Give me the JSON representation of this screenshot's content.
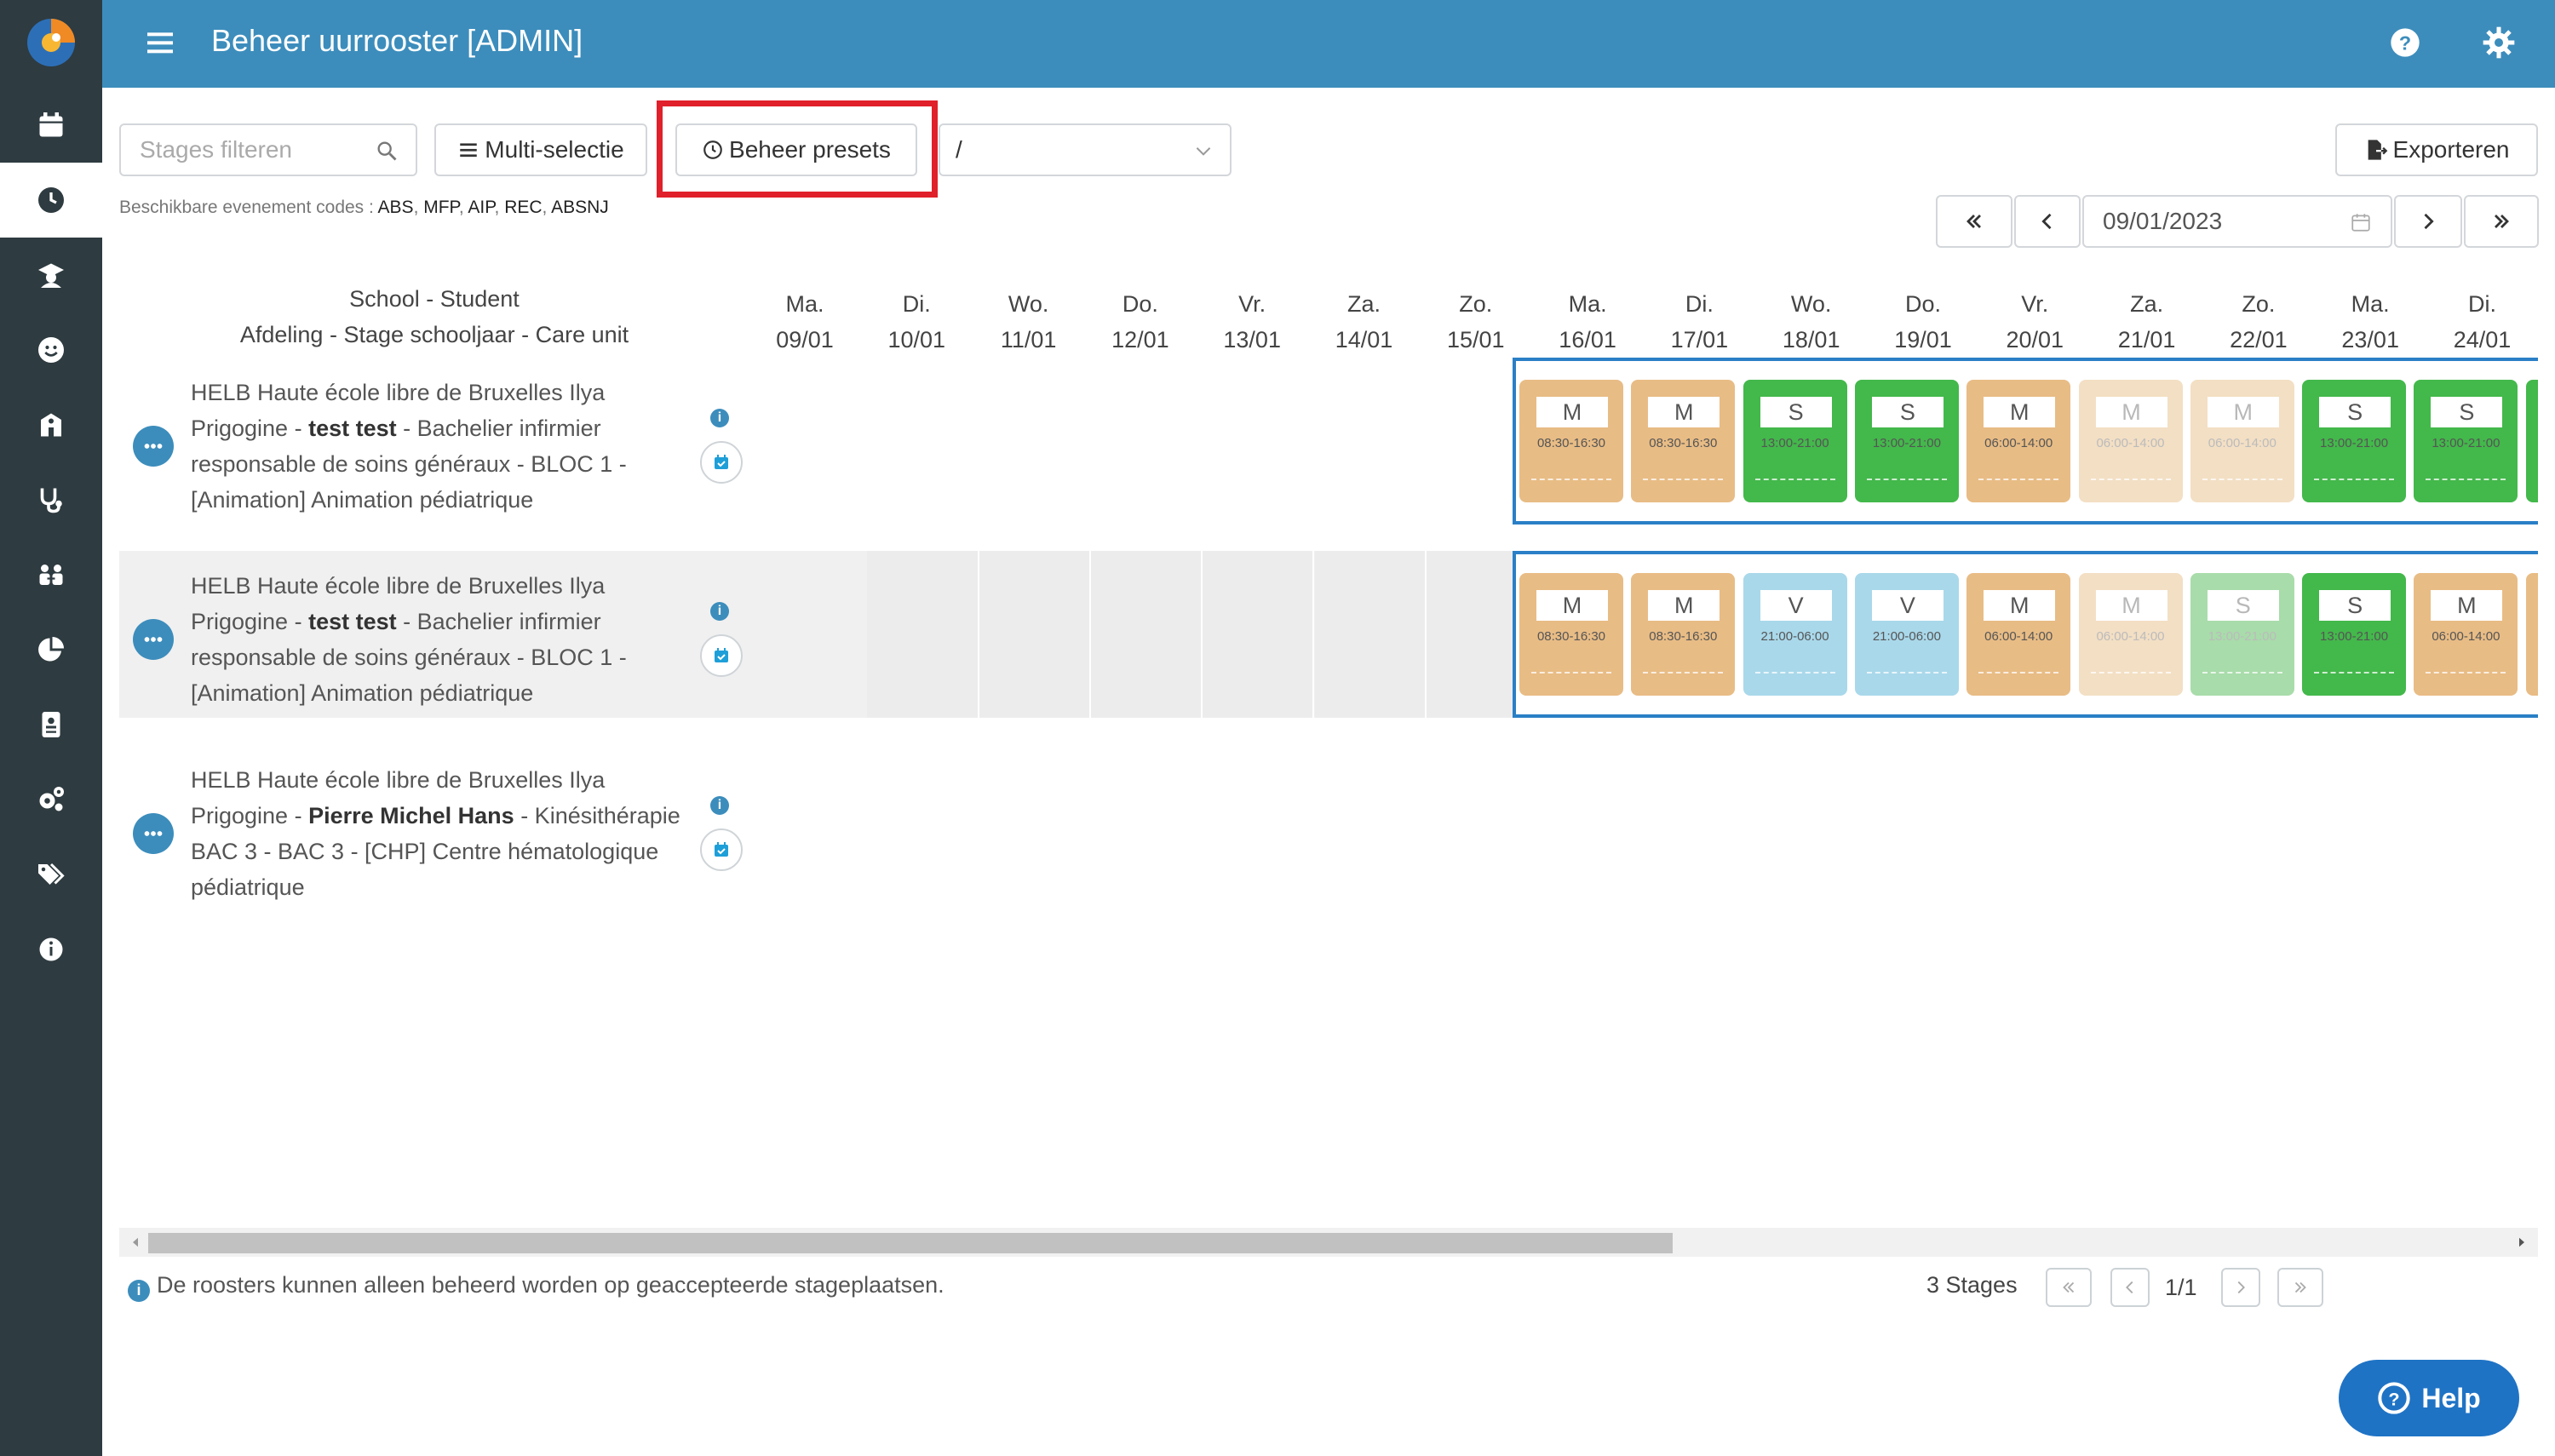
{
  "topbar": {
    "title": "Beheer uurrooster [ADMIN]"
  },
  "sidebar": {
    "items": [
      "calendar-icon",
      "clock-icon",
      "graduate-icon",
      "smile-icon",
      "school-icon",
      "stethoscope-icon",
      "people-icon",
      "pie-chart-icon",
      "id-card-icon",
      "settings-icon",
      "tags-icon",
      "info-icon"
    ],
    "active": "clock-icon"
  },
  "toolbar": {
    "filter_placeholder": "Stages filteren",
    "multi_label": "Multi-selectie",
    "presets_label": "Beheer presets",
    "select_value": "/",
    "export_label": "Exporteren"
  },
  "codes": {
    "label": "Beschikbare evenement codes :",
    "list": [
      "ABS",
      "MFP",
      "AIP",
      "REC",
      "ABSNJ"
    ]
  },
  "date_nav": {
    "date": "09/01/2023"
  },
  "header": {
    "line1": "School - Student",
    "line2": "Afdeling - Stage schooljaar - Care unit"
  },
  "days": [
    {
      "d": "Ma.",
      "date": "09/01"
    },
    {
      "d": "Di.",
      "date": "10/01"
    },
    {
      "d": "Wo.",
      "date": "11/01"
    },
    {
      "d": "Do.",
      "date": "12/01"
    },
    {
      "d": "Vr.",
      "date": "13/01"
    },
    {
      "d": "Za.",
      "date": "14/01"
    },
    {
      "d": "Zo.",
      "date": "15/01"
    },
    {
      "d": "Ma.",
      "date": "16/01"
    },
    {
      "d": "Di.",
      "date": "17/01"
    },
    {
      "d": "Wo.",
      "date": "18/01"
    },
    {
      "d": "Do.",
      "date": "19/01"
    },
    {
      "d": "Vr.",
      "date": "20/01"
    },
    {
      "d": "Za.",
      "date": "21/01"
    },
    {
      "d": "Zo.",
      "date": "22/01"
    },
    {
      "d": "Ma.",
      "date": "23/01"
    },
    {
      "d": "Di.",
      "date": "24/01"
    }
  ],
  "rows": [
    {
      "lines": [
        "HELB Haute école libre de Bruxelles Ilya",
        "Prigogine - ",
        "test test",
        " - Bachelier infirmier",
        "responsable de soins généraux - BLOC 1 -",
        "[Animation] Animation pédiatrique"
      ],
      "shifts": [
        {
          "code": "M",
          "time": "08:30-16:30",
          "color": "#e8bc85",
          "faded": false
        },
        {
          "code": "M",
          "time": "08:30-16:30",
          "color": "#e8bc85",
          "faded": false
        },
        {
          "code": "S",
          "time": "13:00-21:00",
          "color": "#43b84b",
          "faded": false
        },
        {
          "code": "S",
          "time": "13:00-21:00",
          "color": "#43b84b",
          "faded": false
        },
        {
          "code": "M",
          "time": "06:00-14:00",
          "color": "#e8bc85",
          "faded": false
        },
        {
          "code": "M",
          "time": "06:00-14:00",
          "color": "#f3dfc4",
          "faded": true
        },
        {
          "code": "M",
          "time": "06:00-14:00",
          "color": "#f3dfc4",
          "faded": true
        },
        {
          "code": "S",
          "time": "13:00-21:00",
          "color": "#43b84b",
          "faded": false
        },
        {
          "code": "S",
          "time": "13:00-21:00",
          "color": "#43b84b",
          "faded": false
        }
      ]
    },
    {
      "lines": [
        "HELB Haute école libre de Bruxelles Ilya",
        "Prigogine - ",
        "test test",
        " - Bachelier infirmier",
        "responsable de soins généraux - BLOC 1 -",
        "[Animation] Animation pédiatrique"
      ],
      "shifts": [
        {
          "code": "M",
          "time": "08:30-16:30",
          "color": "#e8bc85",
          "faded": false
        },
        {
          "code": "M",
          "time": "08:30-16:30",
          "color": "#e8bc85",
          "faded": false
        },
        {
          "code": "V",
          "time": "21:00-06:00",
          "color": "#a9d8ea",
          "faded": false
        },
        {
          "code": "V",
          "time": "21:00-06:00",
          "color": "#a9d8ea",
          "faded": false
        },
        {
          "code": "M",
          "time": "06:00-14:00",
          "color": "#e8bc85",
          "faded": false
        },
        {
          "code": "M",
          "time": "06:00-14:00",
          "color": "#f3dfc4",
          "faded": true
        },
        {
          "code": "S",
          "time": "13:00-21:00",
          "color": "#a8dcaa",
          "faded": true
        },
        {
          "code": "S",
          "time": "13:00-21:00",
          "color": "#43b84b",
          "faded": false
        },
        {
          "code": "M",
          "time": "06:00-14:00",
          "color": "#e8bc85",
          "faded": false
        }
      ]
    },
    {
      "lines": [
        "HELB Haute école libre de Bruxelles Ilya",
        "Prigogine - ",
        "Pierre Michel Hans",
        " - Kinésithérapie",
        "BAC 3 - BAC 3 - [CHP] Centre hématologique",
        "pédiatrique"
      ],
      "shifts": []
    }
  ],
  "footer": {
    "note": "De roosters kunnen alleen beheerd worden op geaccepteerde stageplaatsen.",
    "count": "3 Stages",
    "page": "1/1"
  },
  "help_label": "Help",
  "colors": {
    "topbar": "#3c8dbc",
    "sidebar": "#2e3b40",
    "highlight": "#e0202a",
    "schedule_border": "#2a7fc6"
  }
}
